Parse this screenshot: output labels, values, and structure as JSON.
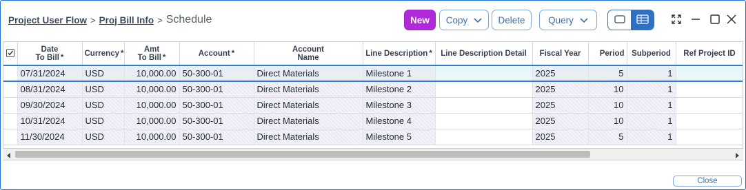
{
  "breadcrumb": {
    "items": [
      "Project User Flow",
      "Proj Bill Info"
    ],
    "separator": ">",
    "current": "Schedule"
  },
  "toolbar": {
    "new_label": "New",
    "copy_label": "Copy",
    "delete_label": "Delete",
    "query_label": "Query"
  },
  "colors": {
    "accent": "#2c7bd6",
    "new_button": "#b02ad9",
    "window_border": "#1f6fd8"
  },
  "icons": [
    "checkbox-icon",
    "chevron-down-icon",
    "single-view-icon",
    "table-view-icon",
    "expand-icon",
    "minimize-icon",
    "maximize-icon",
    "close-icon",
    "scroll-left-icon",
    "scroll-right-icon"
  ],
  "table": {
    "columns": [
      {
        "line1": "Date",
        "line2": "To Bill",
        "required": true
      },
      {
        "line1": "",
        "line2": "Currency",
        "required": true
      },
      {
        "line1": "Amt",
        "line2": "To Bill",
        "required": true
      },
      {
        "line1": "",
        "line2": "Account",
        "required": true
      },
      {
        "line1": "Account",
        "line2": "Name",
        "required": false
      },
      {
        "line1": "",
        "line2": "Line Description",
        "required": true
      },
      {
        "line1": "",
        "line2": "Line Description Detail",
        "required": false
      },
      {
        "line1": "",
        "line2": "Fiscal Year",
        "required": false
      },
      {
        "line1": "",
        "line2": "Period",
        "required": false
      },
      {
        "line1": "",
        "line2": "Subperiod",
        "required": false
      },
      {
        "line1": "",
        "line2": "Ref Project ID",
        "required": false
      }
    ],
    "required_marker": "*",
    "rows": [
      [
        "07/31/2024",
        "USD",
        "10,000.00",
        "50-300-01",
        "Direct Materials",
        "Milestone 1",
        "",
        "2025",
        "5",
        "1",
        ""
      ],
      [
        "08/31/2024",
        "USD",
        "10,000.00",
        "50-300-01",
        "Direct Materials",
        "Milestone 2",
        "",
        "2025",
        "10",
        "1",
        ""
      ],
      [
        "09/30/2024",
        "USD",
        "10,000.00",
        "50-300-01",
        "Direct Materials",
        "Milestone 3",
        "",
        "2025",
        "10",
        "1",
        ""
      ],
      [
        "10/31/2024",
        "USD",
        "10,000.00",
        "50-300-01",
        "Direct Materials",
        "Milestone 4",
        "",
        "2025",
        "10",
        "1",
        ""
      ],
      [
        "11/30/2024",
        "USD",
        "10,000.00",
        "50-300-01",
        "Direct Materials",
        "Milestone 5",
        "",
        "2025",
        "5",
        "1",
        ""
      ]
    ]
  },
  "footer": {
    "close_label": "Close"
  }
}
